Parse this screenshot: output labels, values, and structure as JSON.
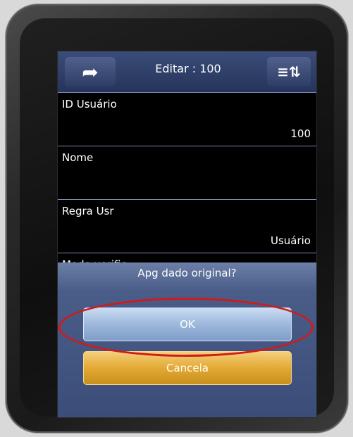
{
  "header": {
    "back_icon": "back-arrow-icon",
    "title": "Editar : 100",
    "sort_icon": "sort-list-icon"
  },
  "fields": [
    {
      "label": "ID Usuário",
      "value": "100"
    },
    {
      "label": "Nome",
      "value": ""
    },
    {
      "label": "Regra Usr",
      "value": "Usuário"
    },
    {
      "label": "Modo verific.",
      "value": ""
    }
  ],
  "dialog": {
    "message": "Apg dado original?",
    "ok_label": "OK",
    "cancel_label": "Cancela"
  },
  "colors": {
    "ok_button": "#9db8dc",
    "cancel_button": "#e3a934",
    "highlight_ellipse": "#d11a1a"
  }
}
